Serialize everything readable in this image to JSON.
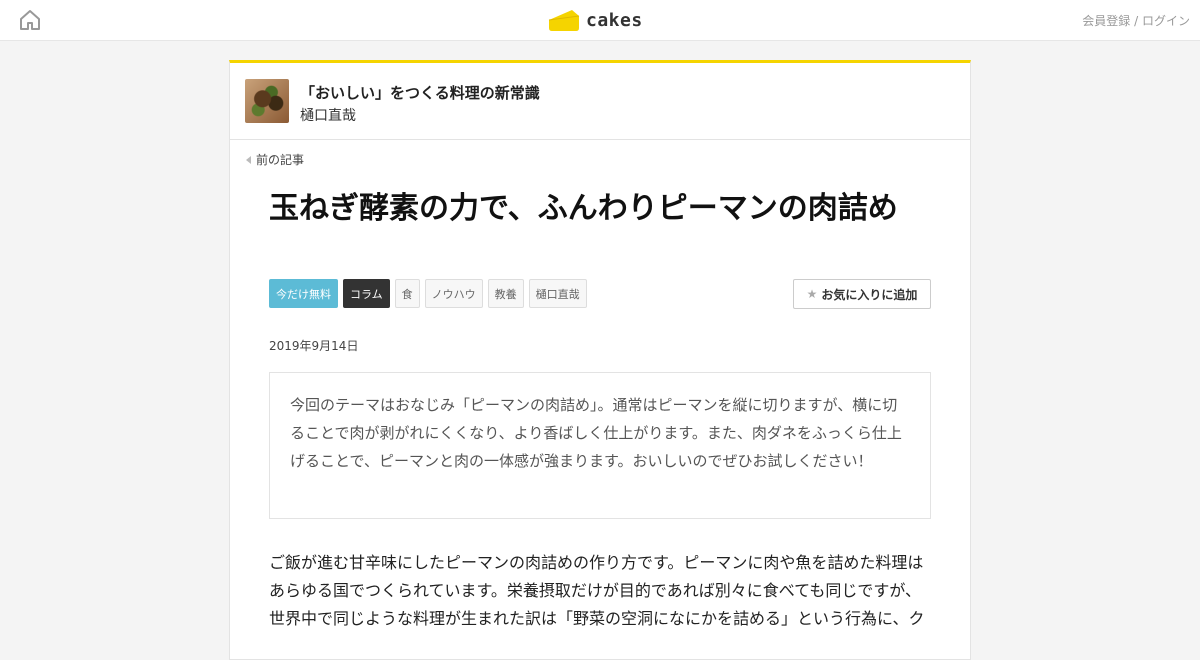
{
  "header": {
    "logo_text": "cakes",
    "auth_register": "会員登録",
    "auth_separator": " / ",
    "auth_login": "ログイン"
  },
  "series": {
    "title": "「おいしい」をつくる料理の新常識",
    "author": "樋口直哉"
  },
  "nav": {
    "prev_label": "前の記事"
  },
  "article": {
    "title": "玉ねぎ酵素の力で、ふんわりピーマンの肉詰め",
    "tags": [
      "今だけ無料",
      "コラム",
      "食",
      "ノウハウ",
      "教養",
      "樋口直哉"
    ],
    "favorite_label": "お気に入りに追加",
    "date": "2019年9月14日",
    "lead": "今回のテーマはおなじみ「ピーマンの肉詰め」。通常はピーマンを縦に切りますが、横に切ることで肉が剥がれにくくなり、より香ばしく仕上がります。また、肉ダネをふっくら仕上げることで、ピーマンと肉の一体感が強まります。おいしいのでぜひお試しください！",
    "body": "ご飯が進む甘辛味にしたピーマンの肉詰めの作り方です。ピーマンに肉や魚を詰めた料理はあらゆる国でつくられています。栄養摂取だけが目的であれば別々に食べても同じですが、世界中で同じような料理が生まれた訳は「野菜の空洞になにかを詰める」という行為に、ク"
  },
  "colors": {
    "accent_yellow": "#f5d400",
    "free_tag": "#5cbbd6",
    "column_tag": "#333333"
  },
  "icons": [
    "home-icon",
    "cake-logo-icon",
    "chevron-left-icon",
    "star-icon"
  ]
}
